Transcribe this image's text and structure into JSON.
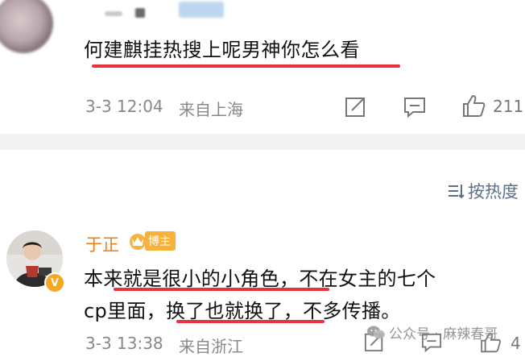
{
  "first_post": {
    "text": "何建麒挂热搜上呢男神你怎么看",
    "date": "3-3 12:04",
    "location": "来自上海",
    "likes": "211"
  },
  "sort": {
    "label": "按热度"
  },
  "reply": {
    "author": "于正",
    "badge": "博主",
    "line1_a": "本",
    "line1_b": "来就是很小的小角色，",
    "line1_c": "不在女主的七个",
    "line2_a": "cp里面，",
    "line2_b": "换了也就换了，",
    "line2_c": "不多传播。",
    "date": "3-3 13:38",
    "location": "来自浙江",
    "likes": "4"
  },
  "watermark": {
    "text": "公众号 · 麻辣春哥"
  },
  "colors": {
    "underline": "#e8333f",
    "author": "#ef7d1a",
    "meta": "#888888",
    "sort": "#5d6f86",
    "badge": "#f6b23d"
  }
}
